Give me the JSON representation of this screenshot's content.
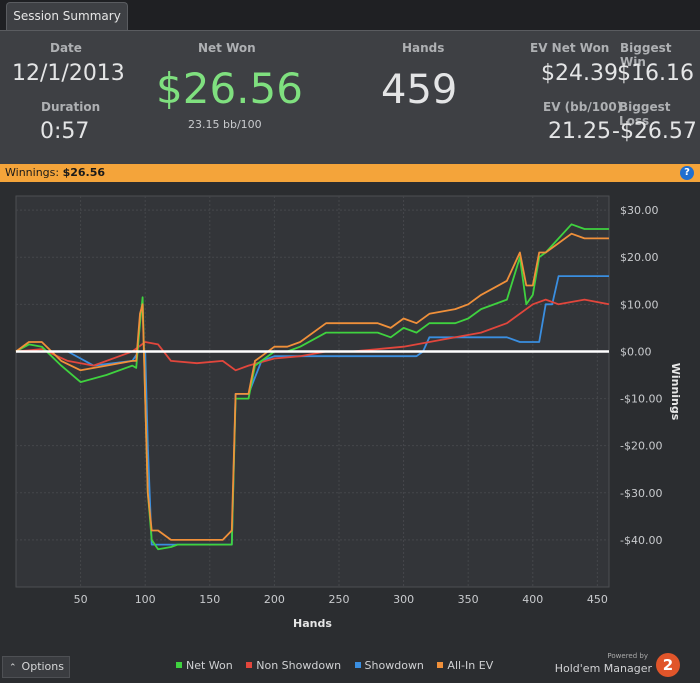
{
  "tab": {
    "label": "Session Summary"
  },
  "summary": {
    "date_label": "Date",
    "date_value": "12/1/2013",
    "duration_label": "Duration",
    "duration_value": "0:57",
    "net_won_label": "Net Won",
    "net_won_value": "$26.56",
    "net_won_bb": "23.15 bb/100",
    "hands_label": "Hands",
    "hands_value": "459",
    "ev_net_won_label": "EV Net Won",
    "ev_net_won_value": "$24.39",
    "biggest_win_label": "Biggest Win",
    "biggest_win_value": "$16.16",
    "ev_bb_label": "EV (bb/100)",
    "ev_bb_value": "21.25",
    "biggest_loss_label": "Biggest Loss",
    "biggest_loss_value": "-$26.57"
  },
  "banner": {
    "label": "Winnings:",
    "value": "$26.56",
    "help_icon": "?"
  },
  "options": {
    "label": "Options",
    "icon": "chevron-up-icon"
  },
  "branding": {
    "powered_by": "Powered by",
    "name": "Hold'em Manager",
    "logo_text": "2"
  },
  "colors": {
    "net_won": "#3fd23f",
    "non_showdown": "#e2463c",
    "showdown": "#3a8ee0",
    "all_in_ev": "#f0903a",
    "zero_line": "#ffffff",
    "banner": "#f4a43a",
    "net_won_value": "#7fe07f"
  },
  "chart_data": {
    "type": "line",
    "xlabel": "Hands",
    "ylabel": "Winnings",
    "xlim": [
      0,
      459
    ],
    "ylim": [
      -50,
      33
    ],
    "xticks": [
      50,
      100,
      150,
      200,
      250,
      300,
      350,
      400,
      450
    ],
    "yticks": [
      30,
      20,
      10,
      0,
      -10,
      -20,
      -30,
      -40
    ],
    "ytick_labels": [
      "$30.00",
      "$20.00",
      "$10.00",
      "$0.00",
      "-$10.00",
      "-$20.00",
      "-$30.00",
      "-$40.00"
    ],
    "grid": true,
    "legend_position": "bottom",
    "series": [
      {
        "name": "Net Won",
        "x": [
          0,
          10,
          20,
          35,
          50,
          70,
          90,
          93,
          96,
          98,
          100,
          102,
          105,
          110,
          120,
          125,
          130,
          140,
          150,
          160,
          167,
          170,
          173,
          180,
          185,
          190,
          200,
          210,
          220,
          240,
          260,
          280,
          290,
          300,
          310,
          320,
          340,
          350,
          360,
          380,
          390,
          395,
          400,
          405,
          410,
          420,
          430,
          440,
          459
        ],
        "y": [
          0,
          1.5,
          1,
          -3,
          -6.5,
          -5,
          -3,
          -3.5,
          6,
          11.5,
          -10,
          -30,
          -40,
          -42,
          -41.5,
          -41,
          -41,
          -41,
          -41,
          -41,
          -41,
          -10,
          -10,
          -10,
          -3,
          -2,
          0,
          0,
          1,
          4,
          4,
          4,
          3,
          5,
          4,
          6,
          6,
          7,
          9,
          11,
          20,
          10,
          12,
          20,
          21,
          24,
          27,
          26,
          26
        ]
      },
      {
        "name": "Non Showdown",
        "x": [
          0,
          20,
          40,
          60,
          80,
          90,
          100,
          110,
          120,
          140,
          160,
          170,
          180,
          200,
          220,
          240,
          260,
          280,
          300,
          320,
          340,
          360,
          380,
          400,
          410,
          420,
          440,
          459
        ],
        "y": [
          0,
          0.5,
          -2,
          -3,
          -1,
          0,
          2,
          1.5,
          -2,
          -2.5,
          -2,
          -4,
          -3,
          -1.5,
          -1,
          0,
          0,
          0.5,
          1,
          2,
          3,
          4,
          6,
          10,
          11,
          10,
          11,
          10
        ]
      },
      {
        "name": "Showdown",
        "x": [
          0,
          40,
          60,
          90,
          95,
          100,
          102,
          105,
          140,
          160,
          167,
          170,
          180,
          190,
          200,
          220,
          310,
          315,
          320,
          380,
          390,
          395,
          400,
          405,
          410,
          415,
          420,
          459
        ],
        "y": [
          0,
          0,
          -3,
          -2,
          0,
          0,
          -20,
          -41,
          -41,
          -41,
          -41,
          -9,
          -9,
          -2,
          -1,
          -1,
          -1,
          0,
          3,
          3,
          2,
          2,
          2,
          2,
          10,
          10,
          16,
          16
        ]
      },
      {
        "name": "All-In EV",
        "x": [
          0,
          10,
          20,
          35,
          50,
          70,
          90,
          93,
          96,
          98,
          100,
          102,
          105,
          110,
          120,
          125,
          130,
          140,
          150,
          160,
          167,
          170,
          173,
          180,
          185,
          190,
          200,
          210,
          220,
          240,
          260,
          280,
          290,
          300,
          310,
          320,
          340,
          350,
          360,
          380,
          390,
          395,
          400,
          405,
          410,
          420,
          430,
          440,
          459
        ],
        "y": [
          0,
          2,
          2,
          -2,
          -4,
          -3,
          -2,
          -2,
          8,
          10,
          -10,
          -30,
          -38,
          -38,
          -40,
          -40,
          -40,
          -40,
          -40,
          -40,
          -38,
          -9,
          -9,
          -9,
          -2,
          -1,
          1,
          1,
          2,
          6,
          6,
          6,
          5,
          7,
          6,
          8,
          9,
          10,
          12,
          15,
          21,
          14,
          14,
          21,
          21,
          23,
          25,
          24,
          24
        ]
      }
    ],
    "zero_line": 0
  }
}
